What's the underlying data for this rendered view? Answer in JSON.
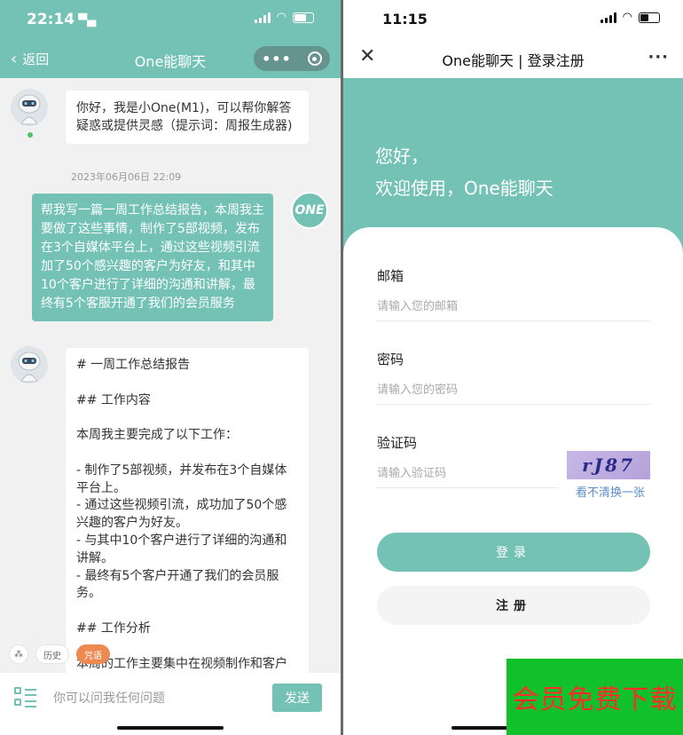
{
  "colors": {
    "accent": "#74c2b6",
    "promo_bg": "#11c12b",
    "promo_text": "#ff2a2a",
    "link": "#5a8fc9"
  },
  "left": {
    "status_time": "22:14",
    "back_label": "返回",
    "title": "One能聊天",
    "bot_greeting": "你好，我是小One(M1)，可以帮你解答疑惑或提供灵感（提示词：周报生成器)",
    "timestamp": "2023年06月06日 22:09",
    "user_message": "帮我写一篇一周工作总结报告，本周我主要做了这些事情，制作了5部视频，发布在3个自媒体平台上，通过这些视频引流加了50个感兴趣的客户为好友，和其中10个客户进行了详细的沟通和讲解，最终有5个客服开通了我们的会员服务",
    "user_avatar_text": "ONE",
    "bot_reply": "# 一周工作总结报告\n\n## 工作内容\n\n本周我主要完成了以下工作：\n\n- 制作了5部视频，并发布在3个自媒体平台上。\n- 通过这些视频引流，成功加了50个感兴趣的客户为好友。\n- 与其中10个客户进行了详细的沟通和讲解。\n- 最终有5个客户开通了我们的会员服务。\n\n## 工作分析\n\n本周的工作主要集中在视频制作和客户",
    "chips": {
      "history": "历史",
      "orange": "咒语"
    },
    "input_placeholder": "你可以问我任何问题",
    "send_label": "发送"
  },
  "right": {
    "status_time": "11:15",
    "close_glyph": "✕",
    "title": "One能聊天 | 登录注册",
    "more_glyph": "···",
    "greeting_line1": "您好，",
    "greeting_line2": "欢迎使用，One能聊天",
    "email_label": "邮箱",
    "email_placeholder": "请输入您的邮箱",
    "password_label": "密码",
    "password_placeholder": "请输入您的密码",
    "captcha_label": "验证码",
    "captcha_placeholder": "请输入验证码",
    "captcha_text": "rJ87",
    "refresh_label": "看不清换一张",
    "login_label": "登录",
    "register_label": "注册"
  },
  "promo": {
    "text": "会员免费下载"
  }
}
